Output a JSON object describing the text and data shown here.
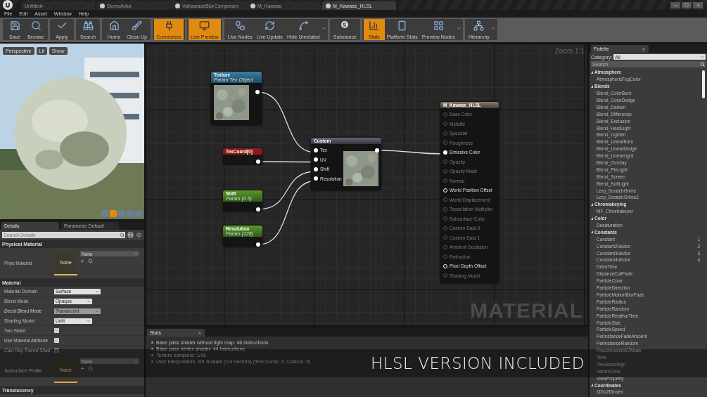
{
  "window": {
    "tabs": [
      {
        "label": "Untitled•",
        "selected": false
      },
      {
        "label": "DemoActor",
        "selected": false
      },
      {
        "label": "VaKawaseBlurComponen",
        "selected": false
      },
      {
        "label": "M_Kawase",
        "selected": false
      },
      {
        "label": "M_Kawase_HLSL",
        "selected": true
      }
    ]
  },
  "menu": [
    "File",
    "Edit",
    "Asset",
    "Window",
    "Help"
  ],
  "toolbar": [
    {
      "label": "Save",
      "active": false,
      "dropdown": false
    },
    {
      "label": "Browse",
      "active": false,
      "dropdown": false
    },
    {
      "label": "Apply",
      "active": false,
      "dropdown": false
    },
    {
      "label": "Search",
      "active": false,
      "dropdown": false
    },
    {
      "label": "Home",
      "active": false,
      "dropdown": false
    },
    {
      "label": "Clean Up",
      "active": false,
      "dropdown": false
    },
    {
      "label": "Connectors",
      "active": true,
      "dropdown": false
    },
    {
      "label": "Live Preview",
      "active": true,
      "dropdown": false
    },
    {
      "label": "Live Nodes",
      "active": false,
      "dropdown": false
    },
    {
      "label": "Live Update",
      "active": false,
      "dropdown": false
    },
    {
      "label": "Hide Unrelated",
      "active": false,
      "dropdown": true
    },
    {
      "label": "Substance",
      "active": false,
      "dropdown": false
    },
    {
      "label": "Stats",
      "active": true,
      "dropdown": false
    },
    {
      "label": "Platform Stats",
      "active": false,
      "dropdown": false
    },
    {
      "label": "Preview Nodes",
      "active": false,
      "dropdown": true
    },
    {
      "label": "Hierarchy",
      "active": false,
      "dropdown": true
    }
  ],
  "viewport": {
    "buttons": [
      "Perspective",
      "Lit",
      "Show"
    ]
  },
  "details": {
    "tabs": [
      {
        "label": "Details",
        "selected": true
      },
      {
        "label": "Parameter Default",
        "selected": false
      }
    ],
    "search": {
      "placeholder": "Search Details"
    },
    "sections": [
      {
        "title": "Physical Material",
        "rows": [
          {
            "kind": "asset",
            "label": "Phys Material",
            "thumb": "None",
            "value": "None",
            "disabled": false
          }
        ]
      },
      {
        "title": "Material",
        "rows": [
          {
            "kind": "dropdown",
            "label": "Material Domain",
            "value": "Surface",
            "disabled": false
          },
          {
            "kind": "dropdown",
            "label": "Blend Mode",
            "value": "Opaque",
            "disabled": false
          },
          {
            "kind": "dropdown",
            "label": "Decal Blend Mode",
            "value": "Translucent",
            "disabled": true
          },
          {
            "kind": "dropdown",
            "label": "Shading Model",
            "value": "Unlit",
            "disabled": false
          },
          {
            "kind": "checkbox",
            "label": "Two Sided",
            "checked": false,
            "disabled": false
          },
          {
            "kind": "checkbox",
            "label": "Use Material Attribute",
            "checked": false,
            "disabled": false
          },
          {
            "kind": "checkbox",
            "label": "Cast Ray Traced Shad",
            "checked": true,
            "disabled": true
          },
          {
            "kind": "asset",
            "label": "Subsurface Profile",
            "thumb": "None",
            "value": "None",
            "disabled": true
          }
        ]
      },
      {
        "title": "Translucency"
      }
    ]
  },
  "graph": {
    "zoom": "Zoom 1:1",
    "watermark": "MATERIAL",
    "texture": {
      "title": "Texture",
      "subtitle": "Param Tex Object"
    },
    "texcoord": {
      "title": "TexCoord[0]"
    },
    "params": [
      {
        "title": "Shift",
        "subtitle": "Param (0.5)"
      },
      {
        "title": "Resolution",
        "subtitle": "Param (128)"
      }
    ],
    "custom": {
      "title": "Custom",
      "inputs": [
        "Tex",
        "UV",
        "Shift",
        "Resolution"
      ]
    },
    "result": {
      "title": "M_Kawase_HLSL",
      "pins": [
        {
          "label": "Base Color",
          "enabled": false,
          "connected": false
        },
        {
          "label": "Metallic",
          "enabled": false,
          "connected": false
        },
        {
          "label": "Specular",
          "enabled": false,
          "connected": false
        },
        {
          "label": "Roughness",
          "enabled": false,
          "connected": false
        },
        {
          "label": "Emissive Color",
          "enabled": true,
          "connected": true
        },
        {
          "label": "Opacity",
          "enabled": false,
          "connected": false
        },
        {
          "label": "Opacity Mask",
          "enabled": false,
          "connected": false
        },
        {
          "label": "Normal",
          "enabled": false,
          "connected": false
        },
        {
          "label": "World Position Offset",
          "enabled": true,
          "connected": false
        },
        {
          "label": "World Displacement",
          "enabled": false,
          "connected": false
        },
        {
          "label": "Tessellation Multiplier",
          "enabled": false,
          "connected": false
        },
        {
          "label": "Subsurface Color",
          "enabled": false,
          "connected": false
        },
        {
          "label": "Custom Data 0",
          "enabled": false,
          "connected": false
        },
        {
          "label": "Custom Data 1",
          "enabled": false,
          "connected": false
        },
        {
          "label": "Ambient Occlusion",
          "enabled": false,
          "connected": false
        },
        {
          "label": "Refraction",
          "enabled": false,
          "connected": false
        },
        {
          "label": "Pixel Depth Offset",
          "enabled": true,
          "connected": false
        },
        {
          "label": "Shading Model",
          "enabled": false,
          "connected": false
        }
      ]
    }
  },
  "stats": {
    "tab": "Stats",
    "lines": [
      "Base pass shader without light map: 46 instructions",
      "Base pass vertex shader: 44 instructions",
      "Texture samplers: 1/16",
      "User interpolators: 2/4 Scalars (1/4 Vectors) (TexCoords: 2, Custom: 0)"
    ]
  },
  "palette": {
    "tab": "Palette",
    "category_label": "Category:",
    "category": "All",
    "search": {
      "placeholder": "Search"
    },
    "groups": [
      {
        "title": "Atmosphere",
        "expanded": true,
        "children": [
          {
            "label": "AtmosphericFogColor"
          }
        ]
      },
      {
        "title": "Blends",
        "expanded": true,
        "children": [
          {
            "label": "Blend_ColorBurn"
          },
          {
            "label": "Blend_ColorDodge"
          },
          {
            "label": "Blend_Darken"
          },
          {
            "label": "Blend_Difference"
          },
          {
            "label": "Blend_Exclusion"
          },
          {
            "label": "Blend_HardLight"
          },
          {
            "label": "Blend_Lighten"
          },
          {
            "label": "Blend_LinearBurn"
          },
          {
            "label": "Blend_LinearDodge"
          },
          {
            "label": "Blend_LinearLight"
          },
          {
            "label": "Blend_Overlay"
          },
          {
            "label": "Blend_PinLight"
          },
          {
            "label": "Blend_Screen"
          },
          {
            "label": "Blend_SoftLight"
          },
          {
            "label": "Lerp_ScratchGrime"
          },
          {
            "label": "Lerp_ScratchGrime2"
          }
        ]
      },
      {
        "title": "Chromakeying",
        "expanded": true,
        "children": [
          {
            "label": "MF_Chromakeyer"
          }
        ]
      },
      {
        "title": "Color",
        "expanded": true,
        "children": [
          {
            "label": "Desaturation"
          }
        ]
      },
      {
        "title": "Constants",
        "expanded": true,
        "children": [
          {
            "label": "Constant",
            "shortcut": "1"
          },
          {
            "label": "Constant2Vector",
            "shortcut": "2"
          },
          {
            "label": "Constant3Vector",
            "shortcut": "3"
          },
          {
            "label": "Constant4Vector",
            "shortcut": "4"
          },
          {
            "label": "DeltaTime"
          },
          {
            "label": "DistanceCullFade"
          },
          {
            "label": "ParticleColor"
          },
          {
            "label": "ParticleDirection"
          },
          {
            "label": "ParticleMotionBlurFade"
          },
          {
            "label": "ParticleRadius"
          },
          {
            "label": "ParticleRandom"
          },
          {
            "label": "ParticleRelativeTime"
          },
          {
            "label": "ParticleSize"
          },
          {
            "label": "ParticleSpeed"
          },
          {
            "label": "PerInstanceFadeAmount"
          },
          {
            "label": "PerInstanceRandom"
          },
          {
            "label": "PrecomputedAOMask"
          },
          {
            "label": "Time"
          },
          {
            "label": "TwoSidedSign"
          },
          {
            "label": "VertexColor"
          },
          {
            "label": "ViewProperty"
          }
        ]
      },
      {
        "title": "Coordinates",
        "expanded": true,
        "children": [
          {
            "label": "1Dto2DIndex"
          }
        ]
      }
    ]
  },
  "banner": "HLSL VERSION INCLUDED"
}
